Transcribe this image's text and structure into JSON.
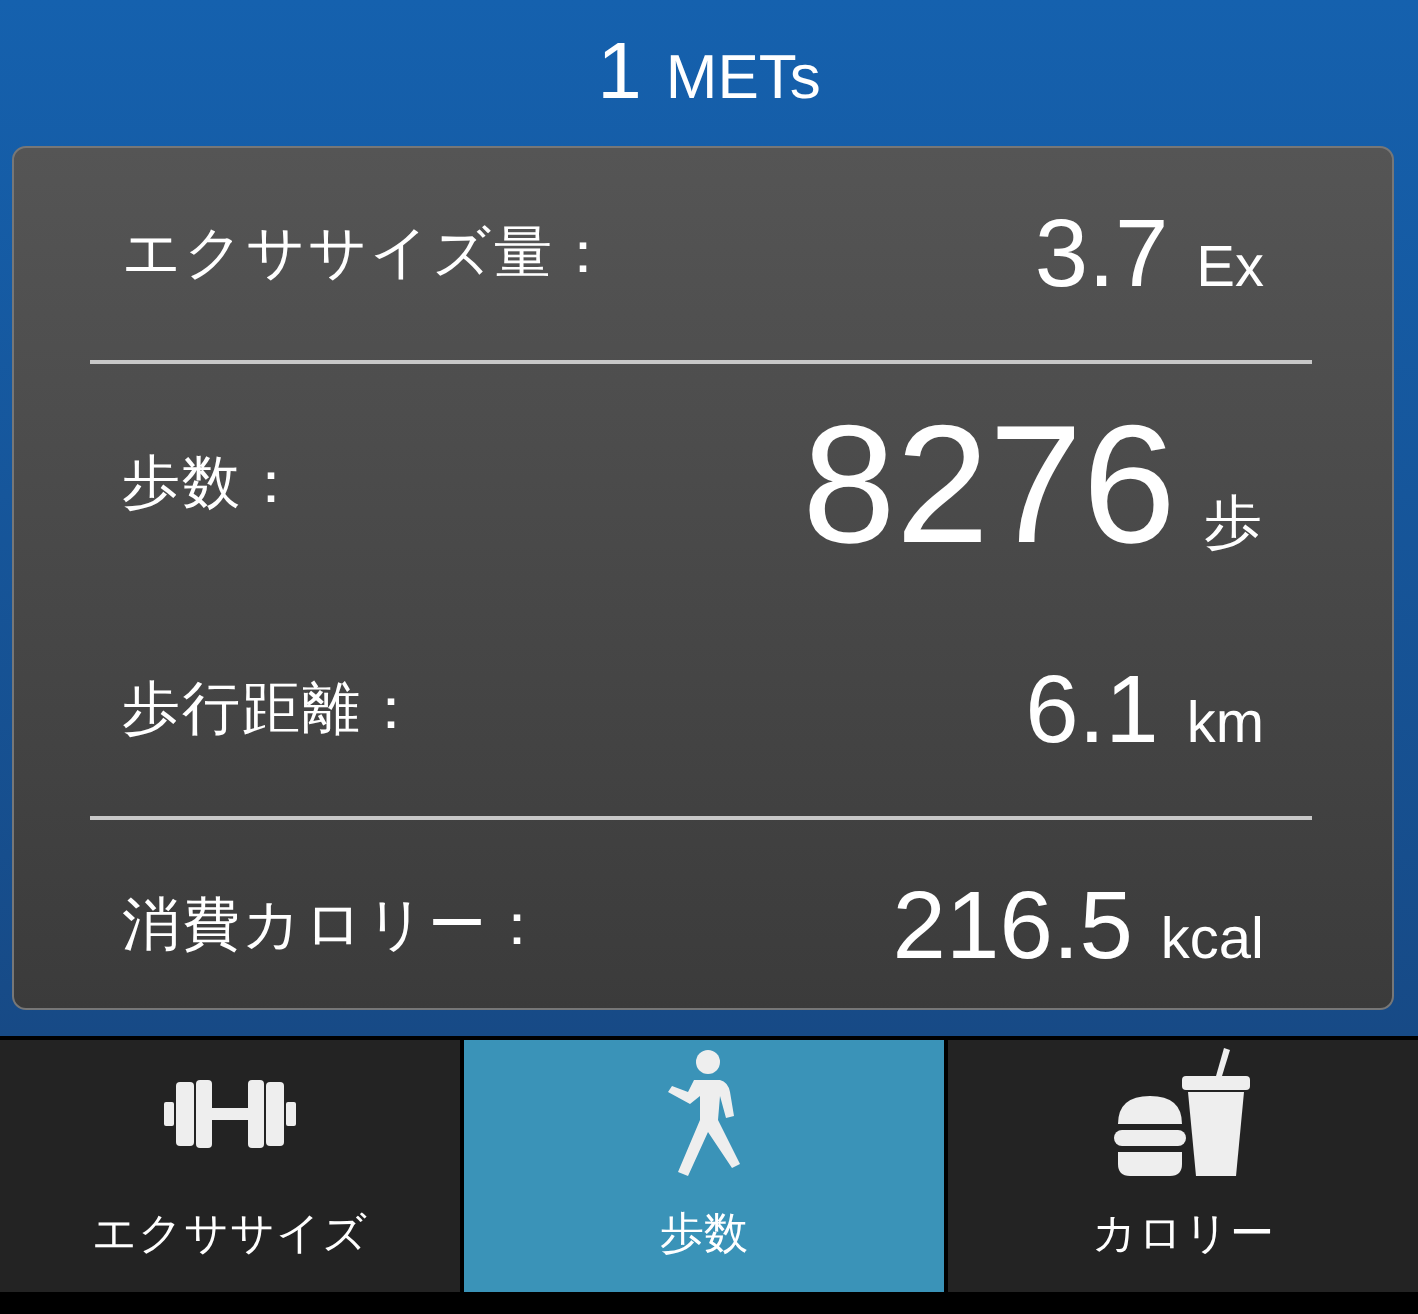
{
  "header": {
    "value": "1",
    "unit": "METs"
  },
  "stats": [
    {
      "label": "エクササイズ量：",
      "value": "3.7",
      "unit": "Ex",
      "emphasis": false,
      "divider_after": true
    },
    {
      "label": "歩数：",
      "value": "8276",
      "unit": "歩",
      "emphasis": true,
      "divider_after": false
    },
    {
      "label": "歩行距離：",
      "value": "6.1",
      "unit": "km",
      "emphasis": false,
      "divider_after": true
    },
    {
      "label": "消費カロリー：",
      "value": "216.5",
      "unit": "kcal",
      "emphasis": false,
      "divider_after": false
    }
  ],
  "tabs": [
    {
      "kind": "exercise",
      "label": "エクササイズ",
      "selected": false
    },
    {
      "kind": "walking",
      "label": "歩数",
      "selected": true
    },
    {
      "kind": "calorie",
      "label": "カロリー",
      "selected": false
    }
  ]
}
